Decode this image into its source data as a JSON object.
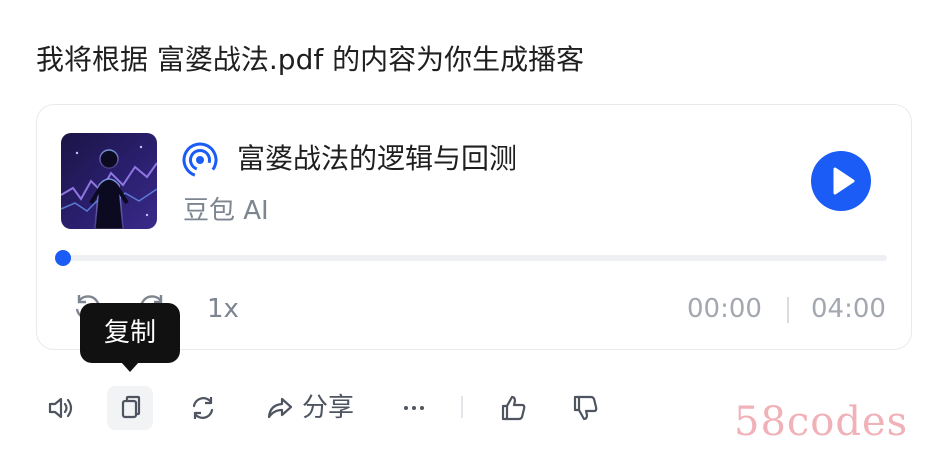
{
  "message": {
    "text": "我将根据 富婆战法.pdf 的内容为你生成播客"
  },
  "podcast": {
    "title": "富婆战法的逻辑与回测",
    "author": "豆包 AI",
    "cover_icon": "podcast-cover-image",
    "play_icon": "play-icon",
    "progress": 0.0,
    "speed_label": "1x",
    "current_time": "00:00",
    "total_time": "04:00",
    "accent_color": "#1a5cf5"
  },
  "tooltip": {
    "label": "复制"
  },
  "actions": {
    "speaker_icon": "speaker-icon",
    "copy_icon": "copy-icon",
    "regenerate_icon": "refresh-icon",
    "share_icon": "share-icon",
    "share_label": "分享",
    "more_icon": "more-icon",
    "like_icon": "thumbs-up-icon",
    "dislike_icon": "thumbs-down-icon"
  },
  "watermark": {
    "text": "58codes"
  }
}
